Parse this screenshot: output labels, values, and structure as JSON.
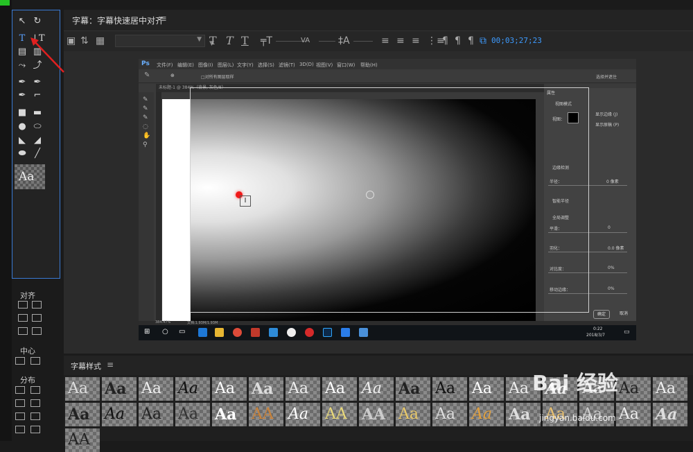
{
  "panel": {
    "title": "字幕：字幕快速居中对齐",
    "menu_icon": "≡",
    "timecode": "00;03;27;23"
  },
  "tools": {
    "preview_text": "Aa",
    "align_label": "对齐",
    "center_label": "中心",
    "distribute_label": "分布"
  },
  "styles": {
    "label": "字幕样式",
    "menu_icon": "≡",
    "swatches": [
      "Aa",
      "Aa",
      "Aa",
      "Aa",
      "Aa",
      "Aa",
      "Aa",
      "Aa",
      "Aa",
      "Aa",
      "Aa",
      "Aa",
      "Aa",
      "Aa",
      "Aa",
      "Aa",
      "Aa",
      "Aa",
      "Aa",
      "Aa",
      "Aa",
      "Aa",
      "AA",
      "Aa",
      "AA",
      "AA",
      "Aa",
      "Aa",
      "Aa",
      "Aa",
      "Aa",
      "Aa",
      "Aa",
      "Aa",
      "AA"
    ]
  },
  "photoshop": {
    "logo": "Ps",
    "menu": [
      "文件(F)",
      "编辑(E)",
      "图像(I)",
      "图层(L)",
      "文字(Y)",
      "选择(S)",
      "滤镜(T)",
      "3D(D)",
      "视图(V)",
      "窗口(W)",
      "帮助(H)"
    ],
    "option_text": "□对所有图层取样",
    "option_right": "选择并遮住",
    "doc_tab": "未标题-1 @ 384%（背景, 灰色/8）",
    "panel_title": "属性",
    "view_mode": "视图模式",
    "view_label": "视图：",
    "show_edges": "显示边缘 (J)",
    "show_original": "显示原稿 (P)",
    "edge_detection": "边缘检测",
    "radius_label": "半径：",
    "radius_value": "0 像素",
    "smart_radius": "智能半径",
    "global_refine": "全局调整",
    "smooth_label": "平滑：",
    "smooth_value": "0",
    "feather_label": "羽化：",
    "feather_value": "0.0 像素",
    "contrast_label": "对比度：",
    "contrast_value": "0%",
    "shift_edge_label": "移动边缘：",
    "shift_edge_value": "0%",
    "ok_button": "确定",
    "cancel_button": "取消",
    "zoom_status": "384.47%",
    "doc_status": "文档:1.93M/1.93M",
    "clock_time": "0:22",
    "clock_date": "2018/3/7"
  },
  "watermark": {
    "brand": "Bai  经验",
    "url": "jingyan.baidu.com"
  },
  "colors": {
    "accent": "#3a7bd5",
    "timecode": "#3d9bff",
    "pointer_dot": "#f01818"
  }
}
